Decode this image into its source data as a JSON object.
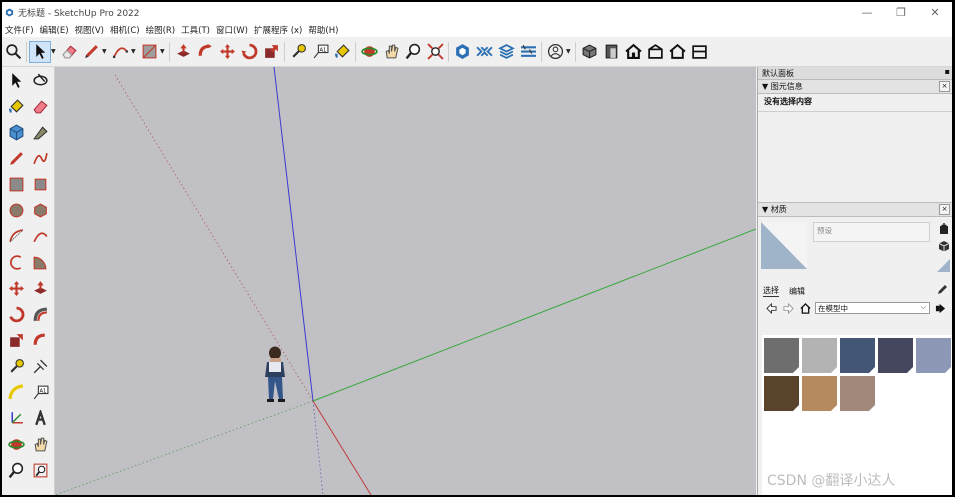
{
  "window": {
    "title": "无标题 - SketchUp Pro 2022",
    "minimize": "—",
    "restore": "❐",
    "close": "✕"
  },
  "menu": [
    "文件(F)",
    "编辑(E)",
    "视图(V)",
    "相机(C)",
    "绘图(R)",
    "工具(T)",
    "窗口(W)",
    "扩展程序 (x)",
    "帮助(H)"
  ],
  "toolbar": {
    "icons": [
      "search-icon",
      "select-icon",
      "eraser-icon",
      "pencil-icon",
      "arc-icon",
      "rectangle-icon",
      "push-pull-icon",
      "follow-me-icon",
      "move-icon",
      "rotate-icon",
      "scale-icon",
      "tape-measure-icon",
      "text-icon",
      "paint-bucket-icon",
      "orbit-icon",
      "pan-icon",
      "zoom-icon",
      "zoom-extents-icon",
      "warehouse-icon",
      "extension-icon",
      "layers-icon",
      "styles-icon",
      "account-icon",
      "iso-view-icon",
      "front-view-icon",
      "home-icon",
      "top-view-icon",
      "back-view-icon"
    ]
  },
  "tray": {
    "title": "默认面板",
    "entity_info": {
      "header": "▼ 图元信息",
      "no_selection": "没有选择内容"
    },
    "materials": {
      "header": "▼ 材质",
      "name_placeholder": "预设",
      "tabs": [
        "选择",
        "编辑"
      ],
      "collection": "在模型中",
      "swatches": [
        "#6e6e6e",
        "#b3b3b3",
        "#435675",
        "#45475f",
        "#8d97b6",
        "#5a432b",
        "#b48a5e",
        "#a1887b"
      ],
      "swatch_preview_color": "#9fb4c8"
    }
  },
  "watermark": "CSDN @翻译小达人",
  "axis_colors": {
    "red": "#c0393a",
    "green": "#3aa83a",
    "blue": "#3a3ad0"
  }
}
